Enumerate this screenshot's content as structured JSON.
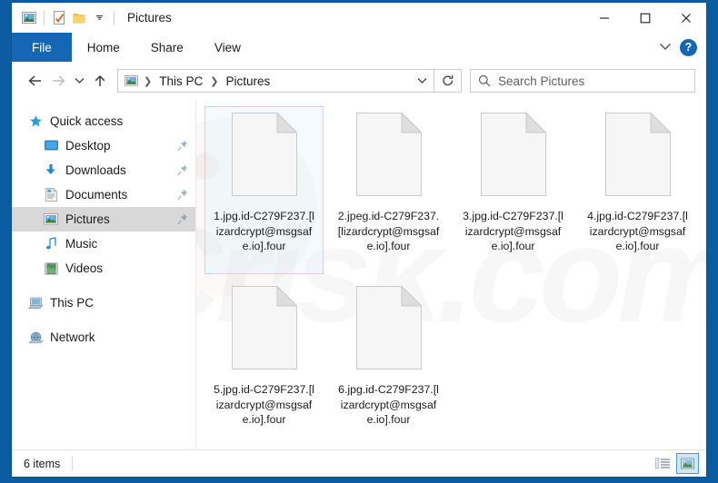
{
  "window": {
    "title": "Pictures",
    "quick_access_icons": [
      "picture-folder-icon",
      "properties-icon",
      "new-folder-icon",
      "customize-dropdown-icon"
    ],
    "controls": {
      "minimize": "minimize-button",
      "maximize": "maximize-button",
      "close": "close-button"
    }
  },
  "ribbon": {
    "tabs": [
      {
        "label": "File",
        "active": true
      },
      {
        "label": "Home",
        "active": false
      },
      {
        "label": "Share",
        "active": false
      },
      {
        "label": "View",
        "active": false
      }
    ],
    "collapse_icon": "chevron-down-icon",
    "help_label": "?"
  },
  "address": {
    "back_icon": "arrow-left-icon",
    "forward_icon": "arrow-right-icon",
    "recent_icon": "chevron-down-icon",
    "up_icon": "arrow-up-icon",
    "breadcrumbs": [
      "This PC",
      "Pictures"
    ],
    "dropdown_icon": "chevron-down-icon",
    "refresh_icon": "refresh-icon"
  },
  "search": {
    "placeholder": "Search Pictures",
    "icon": "search-icon"
  },
  "sidebar": {
    "items": [
      {
        "label": "Quick access",
        "icon": "star-icon",
        "level": 0,
        "pinned": false,
        "selected": false
      },
      {
        "label": "Desktop",
        "icon": "desktop-icon",
        "level": 1,
        "pinned": true,
        "selected": false
      },
      {
        "label": "Downloads",
        "icon": "downloads-icon",
        "level": 1,
        "pinned": true,
        "selected": false
      },
      {
        "label": "Documents",
        "icon": "documents-icon",
        "level": 1,
        "pinned": true,
        "selected": false
      },
      {
        "label": "Pictures",
        "icon": "pictures-icon",
        "level": 1,
        "pinned": true,
        "selected": true
      },
      {
        "label": "Music",
        "icon": "music-icon",
        "level": 1,
        "pinned": false,
        "selected": false
      },
      {
        "label": "Videos",
        "icon": "videos-icon",
        "level": 1,
        "pinned": false,
        "selected": false
      },
      {
        "label": "This PC",
        "icon": "this-pc-icon",
        "level": 0,
        "pinned": false,
        "selected": false
      },
      {
        "label": "Network",
        "icon": "network-icon",
        "level": 0,
        "pinned": false,
        "selected": false
      }
    ]
  },
  "files": [
    {
      "name": "1.jpg.id-C279F237.[lizardcrypt@msgsafe.io].four",
      "selected": true
    },
    {
      "name": "2.jpeg.id-C279F237.[lizardcrypt@msgsafe.io].four",
      "selected": false
    },
    {
      "name": "3.jpg.id-C279F237.[lizardcrypt@msgsafe.io].four",
      "selected": false
    },
    {
      "name": "4.jpg.id-C279F237.[lizardcrypt@msgsafe.io].four",
      "selected": false
    },
    {
      "name": "5.jpg.id-C279F237.[lizardcrypt@msgsafe.io].four",
      "selected": false
    },
    {
      "name": "6.jpg.id-C279F237.[lizardcrypt@msgsafe.io].four",
      "selected": false
    }
  ],
  "statusbar": {
    "item_count": "6 items",
    "views": [
      {
        "icon": "details-view-icon",
        "active": false
      },
      {
        "icon": "large-icons-view-icon",
        "active": true
      }
    ]
  },
  "colors": {
    "desktop": "#0b5ba1",
    "file_tab": "#1567b5",
    "selection_border": "#b6dbf4",
    "sidebar_selected": "#d8d8d8",
    "view_active": "#cfe8f7"
  }
}
